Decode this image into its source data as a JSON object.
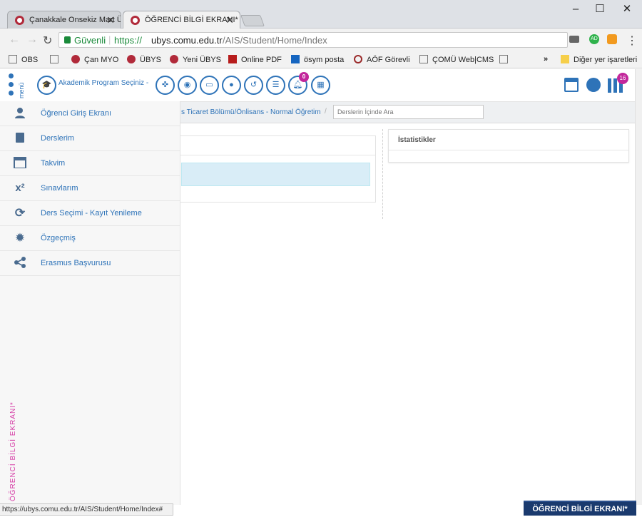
{
  "window": {
    "minimize": "–",
    "maximize": "☐",
    "close": "✕"
  },
  "tabs": [
    {
      "label": "Çanakkale Onsekiz Mart Ü",
      "close": "✕",
      "active": false
    },
    {
      "label": "ÖĞRENCİ BİLGİ EKRANI*",
      "close": "✕",
      "active": true
    }
  ],
  "nav": {
    "back": "←",
    "forward": "→",
    "reload": "↻",
    "secure_label": "Güvenli",
    "url_scheme": "https://",
    "url_host": "ubys.comu.edu.tr",
    "url_path": "/AIS/Student/Home/Index",
    "star": "☆",
    "menu": "⋮"
  },
  "bookmarks": {
    "items": [
      {
        "label": "OBS",
        "icon": "page-icon"
      },
      {
        "label": "",
        "icon": "page-icon"
      },
      {
        "label": "Çan MYO",
        "icon": "comu-icon"
      },
      {
        "label": "ÜBYS",
        "icon": "comu-icon"
      },
      {
        "label": "Yeni ÜBYS",
        "icon": "comu-icon"
      },
      {
        "label": "Online PDF",
        "icon": "pdf-icon"
      },
      {
        "label": "ösym posta",
        "icon": "outlook-icon"
      },
      {
        "label": "AÖF Görevli",
        "icon": "aof-icon"
      },
      {
        "label": "ÇOMÜ Web|CMS",
        "icon": "page-icon"
      },
      {
        "label": "",
        "icon": "page-icon"
      }
    ],
    "overflow": "»",
    "other": "Diğer yer işaretleri"
  },
  "app": {
    "menu_label": "menü",
    "program_select": "Akademik Program Seçiniz -",
    "notification_count": "0",
    "apps_count": "16"
  },
  "breadcrumb": {
    "program": "s Ticaret Bölümü/Önlisans - Normal Öğretim",
    "separator": "/",
    "search_placeholder": "Derslerin İçinde Ara"
  },
  "sidebar": {
    "items": [
      {
        "label": "Öğrenci Giriş Ekranı",
        "icon": "user-icon"
      },
      {
        "label": "Derslerim",
        "icon": "book-icon"
      },
      {
        "label": "Takvim",
        "icon": "calendar-icon"
      },
      {
        "label": "Sınavlarım",
        "icon": "superscript-icon"
      },
      {
        "label": "Ders Seçimi - Kayıt Yenileme",
        "icon": "refresh-icon"
      },
      {
        "label": "Özgeçmiş",
        "icon": "gear-icon"
      },
      {
        "label": "Erasmus Başvurusu",
        "icon": "share-icon"
      }
    ],
    "vertical_label": "ÖĞRENCİ BİLGİ EKRANI*"
  },
  "main": {
    "stats_title": "İstatistikler"
  },
  "status": {
    "url": "https://ubys.comu.edu.tr/AIS/Student/Home/Index#"
  },
  "brand": {
    "badge": "ÖĞRENCİ BİLGİ EKRANI*"
  },
  "colors": {
    "accent": "#2e73b8",
    "badge": "#c2269b",
    "brand_bg": "#1a3a6e"
  }
}
